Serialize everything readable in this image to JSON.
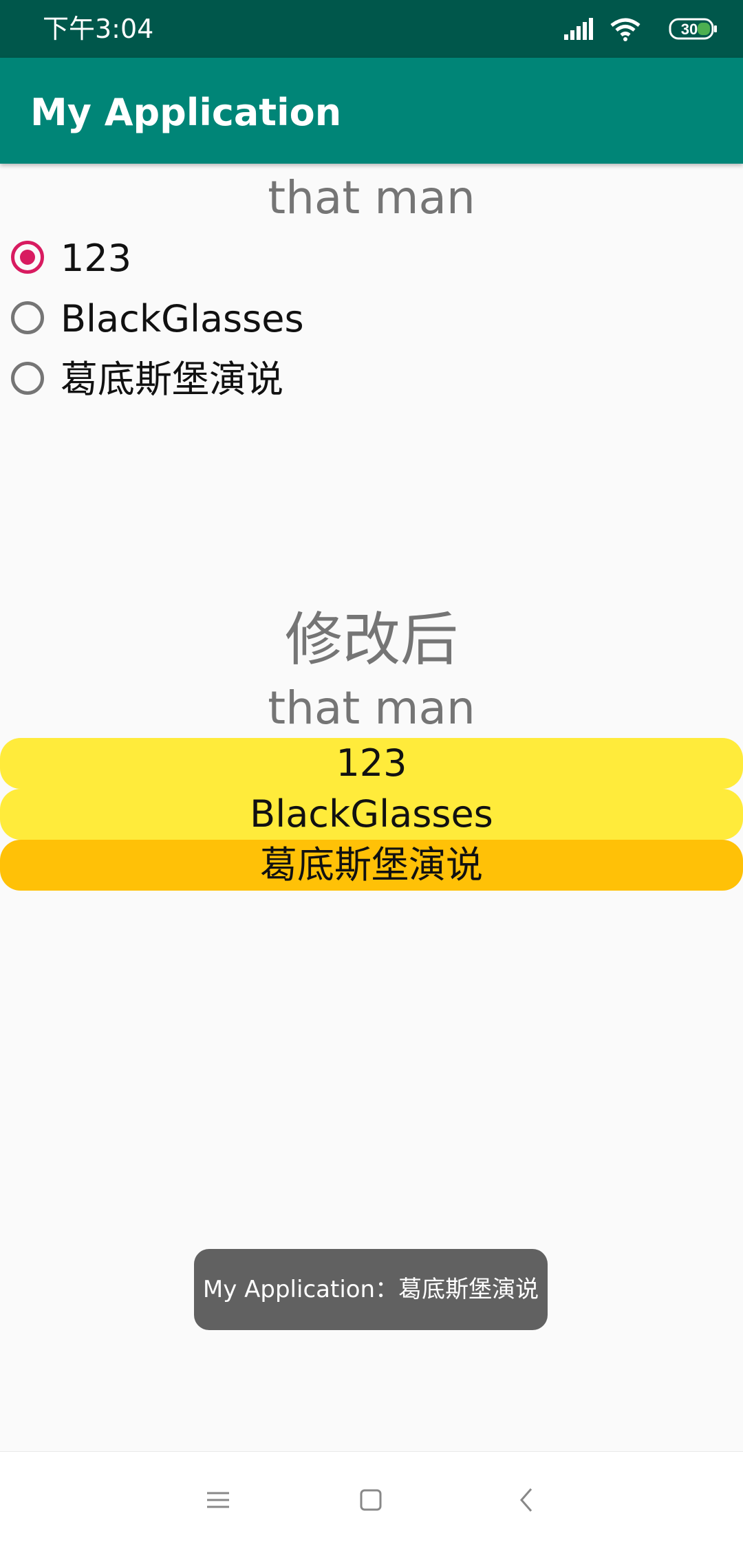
{
  "status_bar": {
    "time": "下午3:04",
    "battery_level": "30",
    "icons": [
      "signal-icon",
      "wifi-icon",
      "battery-icon"
    ]
  },
  "app_bar": {
    "title": "My Application"
  },
  "top_section": {
    "title": "that man",
    "radio_options": [
      {
        "label": "123",
        "checked": true
      },
      {
        "label": "BlackGlasses",
        "checked": false
      },
      {
        "label": "葛底斯堡演说",
        "checked": false
      }
    ]
  },
  "bottom_section": {
    "subtitle": "修改后",
    "title": "that man",
    "options": [
      {
        "label": "123",
        "color": "#ffeb3b"
      },
      {
        "label": "BlackGlasses",
        "color": "#ffeb3b"
      },
      {
        "label": "葛底斯堡演说",
        "color": "#ffc107",
        "selected": true
      }
    ]
  },
  "toast": {
    "message": "My Application：葛底斯堡演说"
  },
  "nav_bar": {
    "buttons": [
      "menu-icon",
      "home-icon",
      "back-icon"
    ]
  },
  "colors": {
    "status_bar": "#00574b",
    "app_bar": "#008577",
    "radio_accent": "#d81b60",
    "option_default": "#ffeb3b",
    "option_selected": "#ffc107"
  }
}
